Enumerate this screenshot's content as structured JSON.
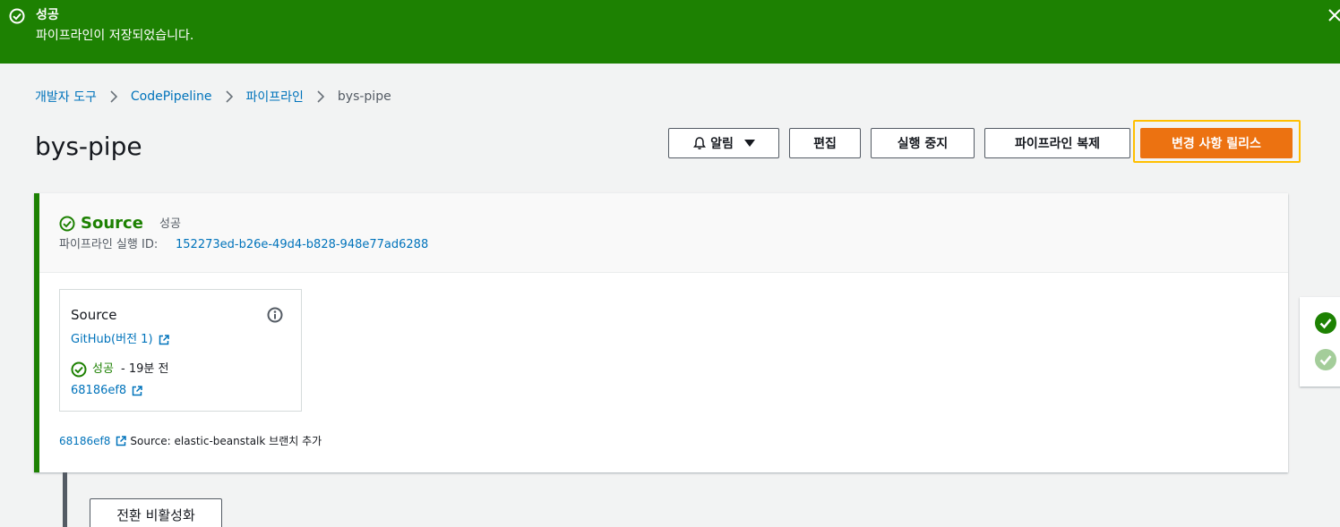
{
  "flash": {
    "title": "성공",
    "message": "파이프라인이 저장되었습니다.",
    "icons": {
      "status": "check-circle-icon",
      "close": "close-icon"
    },
    "color": "#1d8102"
  },
  "breadcrumb": {
    "items": [
      "개발자 도구",
      "CodePipeline",
      "파이프라인"
    ],
    "current": "bys-pipe"
  },
  "page": {
    "title": "bys-pipe"
  },
  "header_actions": {
    "notify": "알림",
    "edit": "편집",
    "stop": "실행 중지",
    "clone": "파이프라인 복제",
    "release": "변경 사항 릴리스",
    "release_color": "#ec7211"
  },
  "stage": {
    "name": "Source",
    "status": "성공",
    "execution_label": "파이프라인 실행 ID:",
    "execution_id": "152273ed-b26e-49d4-b828-948e77ad6288",
    "action": {
      "title": "Source",
      "provider": "GitHub(버전 1)",
      "status": "성공",
      "time": "-  19분 전",
      "commit": "68186ef8"
    },
    "footer": {
      "commit": "68186ef8",
      "message": "Source: elastic-beanstalk 브랜치 추가"
    }
  },
  "transition": {
    "button": "전환 비활성화"
  }
}
